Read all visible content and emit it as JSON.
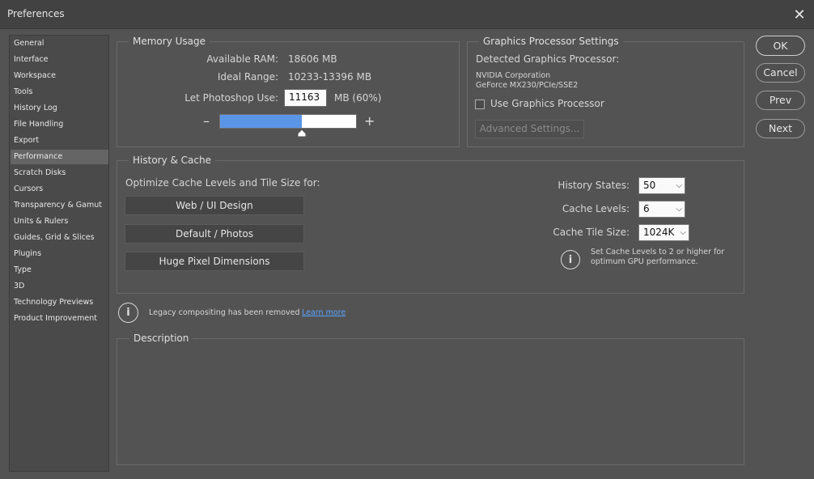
{
  "window": {
    "title": "Preferences",
    "close_glyph": "✕"
  },
  "sidebar": {
    "items": [
      {
        "label": "General"
      },
      {
        "label": "Interface"
      },
      {
        "label": "Workspace"
      },
      {
        "label": "Tools"
      },
      {
        "label": "History Log"
      },
      {
        "label": "File Handling"
      },
      {
        "label": "Export"
      },
      {
        "label": "Performance",
        "selected": true
      },
      {
        "label": "Scratch Disks"
      },
      {
        "label": "Cursors"
      },
      {
        "label": "Transparency & Gamut"
      },
      {
        "label": "Units & Rulers"
      },
      {
        "label": "Guides, Grid & Slices"
      },
      {
        "label": "Plugins"
      },
      {
        "label": "Type"
      },
      {
        "label": "3D"
      },
      {
        "label": "Technology Previews"
      },
      {
        "label": "Product Improvement"
      }
    ]
  },
  "memory": {
    "legend": "Memory Usage",
    "available_label": "Available RAM:",
    "available_value": "18606 MB",
    "ideal_label": "Ideal Range:",
    "ideal_value": "10233-13396 MB",
    "use_label": "Let Photoshop Use:",
    "use_value": "11163",
    "use_suffix": "MB (60%)",
    "minus": "–",
    "plus": "+",
    "slider_fraction": 0.6
  },
  "gpu": {
    "legend": "Graphics Processor Settings",
    "detected_label": "Detected Graphics Processor:",
    "vendor": "NVIDIA Corporation",
    "model": "GeForce MX230/PCIe/SSE2",
    "use_label": "Use Graphics Processor",
    "use_checked": false,
    "advanced_label": "Advanced Settings..."
  },
  "history": {
    "legend": "History & Cache",
    "optimize_label": "Optimize Cache Levels and Tile Size for:",
    "btn_web": "Web / UI Design",
    "btn_default": "Default / Photos",
    "btn_huge": "Huge Pixel Dimensions",
    "states_label": "History States:",
    "states_value": "50",
    "levels_label": "Cache Levels:",
    "levels_value": "6",
    "tile_label": "Cache Tile Size:",
    "tile_value": "1024K",
    "tip_line1": "Set Cache Levels to 2 or higher for",
    "tip_line2": "optimum GPU performance.",
    "info_glyph": "i"
  },
  "legacy": {
    "text": "Legacy compositing has been removed",
    "link": "Learn more",
    "info_glyph": "i"
  },
  "description": {
    "legend": "Description"
  },
  "buttons": {
    "ok": "OK",
    "cancel": "Cancel",
    "prev": "Prev",
    "next": "Next"
  },
  "colors": {
    "accent": "#5b95e6",
    "link": "#5aa3ff",
    "background": "#535353"
  }
}
